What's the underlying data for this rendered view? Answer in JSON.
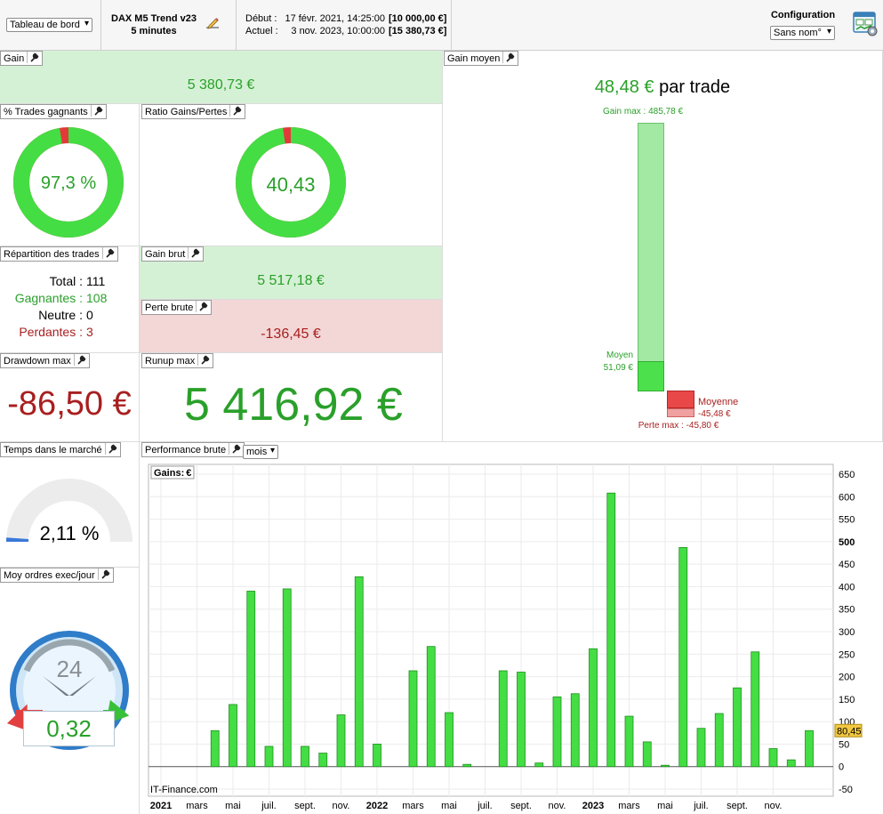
{
  "toolbar": {
    "dashboard_select": "Tableau de bord",
    "strategy_name": "DAX M5 Trend v23",
    "timeframe": "5 minutes",
    "start_label": "Début :",
    "start_date": "17 févr. 2021, 14:25:00",
    "start_capital": "[10 000,00 €]",
    "current_label": "Actuel :",
    "current_date": "3 nov. 2023, 10:00:00",
    "current_capital": "[15 380,73 €]",
    "config_label": "Configuration",
    "config_select": "Sans nom°"
  },
  "gain": {
    "title": "Gain",
    "value": "5 380,73 €"
  },
  "gain_moyen": {
    "title": "Gain moyen",
    "value": "48,48 €",
    "suffix": "par trade",
    "gain_max_label": "Gain max : 485,78 €",
    "moyen_label": "Moyen",
    "moyen_value": "51,09 €",
    "moyenne_label": "Moyenne",
    "moyenne_value": "-45,48 €",
    "perte_max_label": "Perte max : -45,80 €"
  },
  "pct_trades": {
    "title": "% Trades gagnants",
    "value": "97,3 %",
    "fraction": 0.973
  },
  "ratio": {
    "title": "Ratio Gains/Pertes",
    "value": "40,43",
    "fraction": 0.976
  },
  "repartition": {
    "title": "Répartition des trades",
    "total_label": "Total :",
    "total": "111",
    "gagnantes_label": "Gagnantes :",
    "gagnantes": "108",
    "neutre_label": "Neutre :",
    "neutre": "0",
    "perdantes_label": "Perdantes :",
    "perdantes": "3"
  },
  "gain_brut": {
    "title": "Gain brut",
    "value": "5 517,18 €"
  },
  "perte_brute": {
    "title": "Perte brute",
    "value": "-136,45 €"
  },
  "drawdown": {
    "title": "Drawdown max",
    "value": "-86,50 €"
  },
  "runup": {
    "title": "Runup max",
    "value": "5 416,92 €"
  },
  "temps": {
    "title": "Temps dans le marché",
    "value": "2,11 %",
    "fraction": 0.0211
  },
  "ordres": {
    "title": "Moy ordres exec/jour",
    "value": "0,32",
    "clock_label": "24"
  },
  "perf": {
    "title": "Performance brute",
    "period_select": "mois",
    "chart_legend": "Gains:",
    "legend_unit": "€",
    "watermark": "IT-Finance.com"
  },
  "colors": {
    "green": "#2aa02a",
    "red": "#a81f1f",
    "bar_fill": "#44dd44",
    "bar_stroke": "#1f8f1f"
  },
  "chart_data": {
    "type": "bar",
    "ylim": [
      -50,
      650
    ],
    "yticks": [
      "650",
      "600",
      "550",
      "500",
      "450",
      "400",
      "350",
      "300",
      "250",
      "200",
      "150",
      "100",
      "50",
      "0",
      "-50"
    ],
    "ytick_values": [
      650,
      600,
      550,
      500,
      450,
      400,
      350,
      300,
      250,
      200,
      150,
      100,
      50,
      0,
      -50
    ],
    "last_value_label": "80,45",
    "x_labels": [
      "2021",
      "mars",
      "mai",
      "juil.",
      "sept.",
      "nov.",
      "2022",
      "mars",
      "mai",
      "juil.",
      "sept.",
      "nov.",
      "2023",
      "mars",
      "mai",
      "juil.",
      "sept.",
      "nov."
    ],
    "x_label_bold": [
      true,
      false,
      false,
      false,
      false,
      false,
      true,
      false,
      false,
      false,
      false,
      false,
      true,
      false,
      false,
      false,
      false,
      false
    ],
    "values": [
      0,
      0,
      0,
      80,
      138,
      390,
      45,
      395,
      45,
      30,
      115,
      422,
      50,
      0,
      213,
      267,
      120,
      5,
      0,
      213,
      210,
      8,
      155,
      162,
      262,
      608,
      112,
      55,
      3,
      487,
      85,
      118,
      175,
      255,
      40,
      15,
      80
    ]
  }
}
